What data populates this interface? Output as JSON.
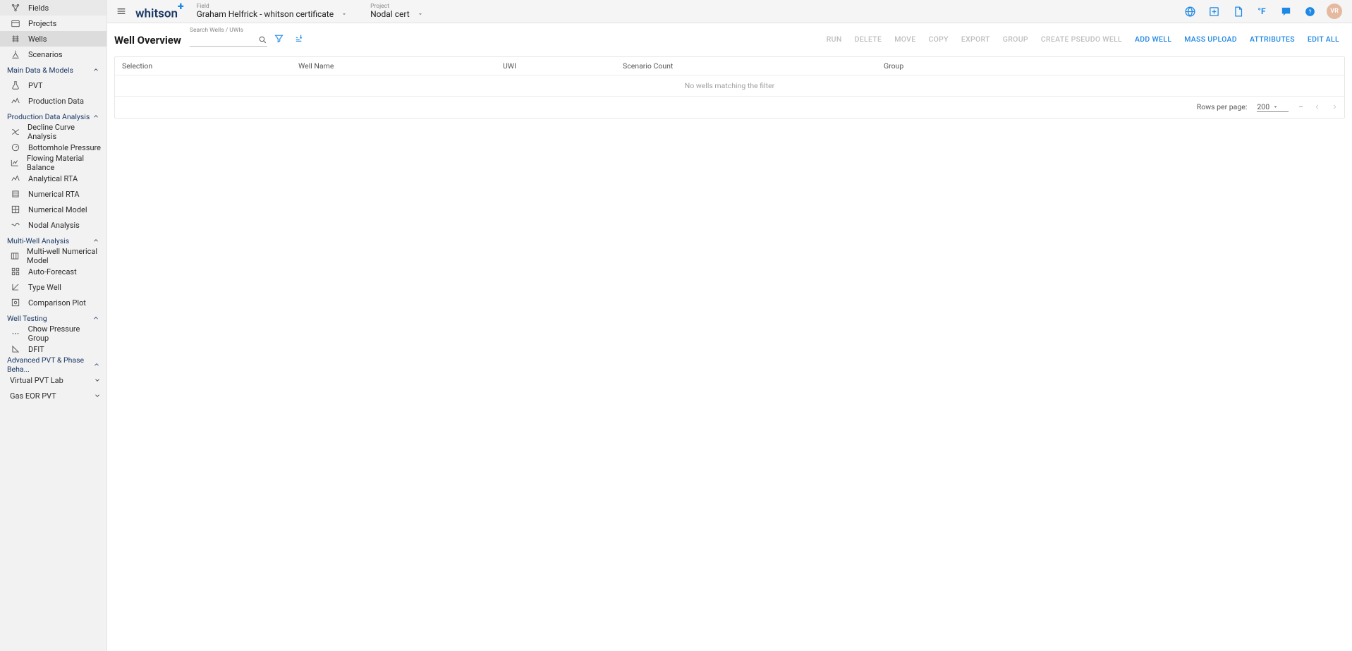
{
  "brand": "whitson",
  "header": {
    "field_label": "Field",
    "field_value": "Graham Helfrick - whitson certificate",
    "project_label": "Project",
    "project_value": "Nodal cert",
    "unit_label": "°F",
    "avatar_initials": "VR"
  },
  "sidebar": {
    "top": [
      {
        "label": "Fields",
        "icon": "fields"
      },
      {
        "label": "Projects",
        "icon": "projects"
      },
      {
        "label": "Wells",
        "icon": "wells",
        "active": true
      },
      {
        "label": "Scenarios",
        "icon": "scenarios"
      }
    ],
    "groups": [
      {
        "label": "Main Data & Models",
        "items": [
          {
            "label": "PVT",
            "icon": "flask"
          },
          {
            "label": "Production Data",
            "icon": "spark"
          }
        ]
      },
      {
        "label": "Production Data Analysis",
        "items": [
          {
            "label": "Decline Curve Analysis",
            "icon": "dca"
          },
          {
            "label": "Bottomhole Pressure",
            "icon": "gauge"
          },
          {
            "label": "Flowing Material Balance",
            "icon": "linechart"
          },
          {
            "label": "Analytical RTA",
            "icon": "spark"
          },
          {
            "label": "Numerical RTA",
            "icon": "layers"
          },
          {
            "label": "Numerical Model",
            "icon": "grid"
          },
          {
            "label": "Nodal Analysis",
            "icon": "wave"
          }
        ]
      },
      {
        "label": "Multi-Well Analysis",
        "items": [
          {
            "label": "Multi-well Numerical Model",
            "icon": "columns"
          },
          {
            "label": "Auto-Forecast",
            "icon": "apps"
          },
          {
            "label": "Type Well",
            "icon": "corner"
          },
          {
            "label": "Comparison Plot",
            "icon": "compare"
          }
        ]
      },
      {
        "label": "Well Testing",
        "items": [
          {
            "label": "Chow Pressure Group",
            "icon": "dots"
          },
          {
            "label": "DFIT",
            "icon": "triangle"
          }
        ]
      },
      {
        "label": "Advanced PVT & Phase Beha...",
        "subgroups": [
          {
            "label": "Virtual PVT Lab"
          },
          {
            "label": "Gas EOR PVT"
          }
        ]
      }
    ]
  },
  "page": {
    "title": "Well Overview",
    "search_label": "Search Wells / UWIs",
    "toolbar": [
      {
        "label": "RUN",
        "enabled": false
      },
      {
        "label": "DELETE",
        "enabled": false
      },
      {
        "label": "MOVE",
        "enabled": false
      },
      {
        "label": "COPY",
        "enabled": false
      },
      {
        "label": "EXPORT",
        "enabled": false
      },
      {
        "label": "GROUP",
        "enabled": false
      },
      {
        "label": "CREATE PSEUDO WELL",
        "enabled": false
      },
      {
        "label": "ADD WELL",
        "enabled": true
      },
      {
        "label": "MASS UPLOAD",
        "enabled": true
      },
      {
        "label": "ATTRIBUTES",
        "enabled": true
      },
      {
        "label": "EDIT ALL",
        "enabled": true
      }
    ],
    "table": {
      "columns": {
        "selection": "Selection",
        "well_name": "Well Name",
        "uwi": "UWI",
        "scenario_count": "Scenario Count",
        "group": "Group"
      },
      "empty_text": "No wells matching the filter",
      "footer": {
        "rows_per_page_label": "Rows per page:",
        "rows_per_page_value": "200",
        "range": "–"
      }
    }
  }
}
